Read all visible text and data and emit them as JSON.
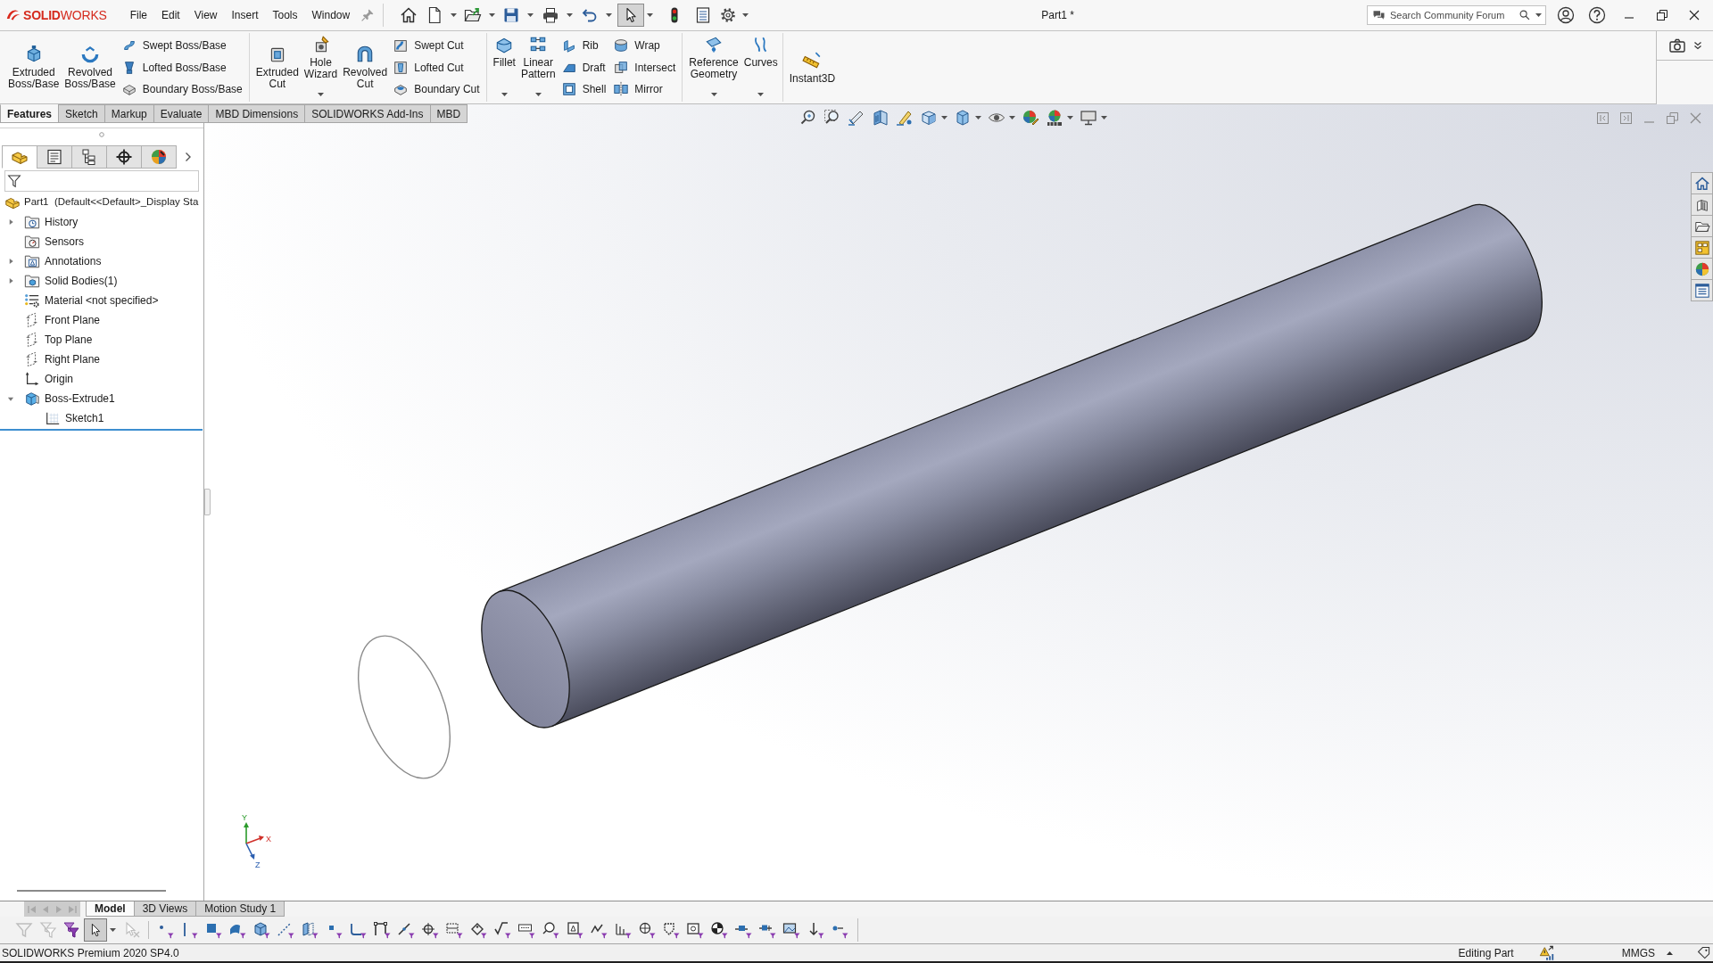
{
  "title_bar": {
    "logo": "**SOLID**WORKS",
    "menu": [
      {
        "label": "File"
      },
      {
        "label": "Edit"
      },
      {
        "label": "View"
      },
      {
        "label": "Insert"
      },
      {
        "label": "Tools"
      },
      {
        "label": "Window"
      }
    ],
    "title": "Part1 *",
    "search": {
      "placeholder": "Search Community Forum"
    }
  },
  "quick_access": {
    "select_active": true
  },
  "ribbon": [
    {
      "columns": [
        {
          "kind": "large",
          "label": "Extruded Boss/Base",
          "dropdown": false
        },
        {
          "kind": "large",
          "label": "Revolved Boss/Base",
          "dropdown": false
        },
        {
          "kind": "stack",
          "items": [
            {
              "label": "Swept Boss/Base"
            },
            {
              "label": "Lofted Boss/Base"
            },
            {
              "label": "Boundary Boss/Base"
            }
          ]
        }
      ]
    },
    {
      "columns": [
        {
          "kind": "large",
          "label": "Extruded Cut",
          "dropdown": false
        },
        {
          "kind": "large",
          "label": "Hole Wizard",
          "dropdown": true
        },
        {
          "kind": "large",
          "label": "Revolved Cut",
          "dropdown": false
        },
        {
          "kind": "stack",
          "items": [
            {
              "label": "Swept Cut"
            },
            {
              "label": "Lofted Cut"
            },
            {
              "label": "Boundary Cut"
            }
          ]
        }
      ]
    },
    {
      "columns": [
        {
          "kind": "large",
          "label": "Fillet",
          "dropdown": true
        },
        {
          "kind": "large",
          "label": "Linear Pattern",
          "dropdown": true
        },
        {
          "kind": "stack",
          "items": [
            {
              "label": "Rib"
            },
            {
              "label": "Draft"
            },
            {
              "label": "Shell"
            }
          ]
        },
        {
          "kind": "stack",
          "items": [
            {
              "label": "Wrap"
            },
            {
              "label": "Intersect"
            },
            {
              "label": "Mirror"
            }
          ]
        }
      ]
    },
    {
      "columns": [
        {
          "kind": "large",
          "label": "Reference Geometry",
          "dropdown": true
        },
        {
          "kind": "large",
          "label": "Curves",
          "dropdown": true
        }
      ]
    },
    {
      "columns": [
        {
          "kind": "large",
          "label": "Instant3D",
          "dropdown": false
        }
      ]
    }
  ],
  "command_tabs": [
    {
      "label": "Features",
      "selected": true
    },
    {
      "label": "Sketch",
      "selected": false
    },
    {
      "label": "Markup",
      "selected": false
    },
    {
      "label": "Evaluate",
      "selected": false
    },
    {
      "label": "MBD Dimensions",
      "selected": false
    },
    {
      "label": "SOLIDWORKS Add-Ins",
      "selected": false
    },
    {
      "label": "MBD",
      "selected": false
    }
  ],
  "feature_manager": {
    "tabs": [
      {
        "kind": "feature-tree",
        "selected": true
      },
      {
        "kind": "property",
        "selected": false
      },
      {
        "kind": "configuration",
        "selected": false
      },
      {
        "kind": "dimxpert",
        "selected": false
      },
      {
        "kind": "display",
        "selected": false
      }
    ],
    "tree": {
      "label": "Part1  (Default<<Default>_Display Sta",
      "kind": "part",
      "children": [
        {
          "label": "History",
          "kind": "history",
          "expandable": true,
          "expanded": false
        },
        {
          "label": "Sensors",
          "kind": "sensors",
          "expandable": false
        },
        {
          "label": "Annotations",
          "kind": "annotations",
          "expandable": true,
          "expanded": false
        },
        {
          "label": "Solid Bodies(1)",
          "kind": "bodies",
          "expandable": true,
          "expanded": false
        },
        {
          "label": "Material <not specified>",
          "kind": "material",
          "expandable": false
        },
        {
          "label": "Front Plane",
          "kind": "plane",
          "expandable": false
        },
        {
          "label": "Top Plane",
          "kind": "plane",
          "expandable": false
        },
        {
          "label": "Right Plane",
          "kind": "plane",
          "expandable": false
        },
        {
          "label": "Origin",
          "kind": "origin",
          "expandable": false
        },
        {
          "label": "Boss-Extrude1",
          "kind": "feature",
          "expandable": true,
          "expanded": true,
          "children": [
            {
              "label": "Sketch1",
              "kind": "sketch",
              "expandable": false
            }
          ]
        }
      ]
    }
  },
  "graphics": {
    "triad": {
      "x": "X",
      "y": "Y",
      "z": "Z"
    }
  },
  "bottom_tabs": {
    "nav_disabled": true,
    "tabs": [
      {
        "label": "Model",
        "selected": true
      },
      {
        "label": "3D Views",
        "selected": false
      },
      {
        "label": "Motion Study 1",
        "selected": false
      }
    ]
  },
  "selection_filter": {
    "filters_disabled": true,
    "select_active": true,
    "clear_disabled": true
  },
  "status_bar": {
    "version": "SOLIDWORKS Premium 2020 SP4.0",
    "mode": "Editing Part",
    "units": "MMGS"
  }
}
